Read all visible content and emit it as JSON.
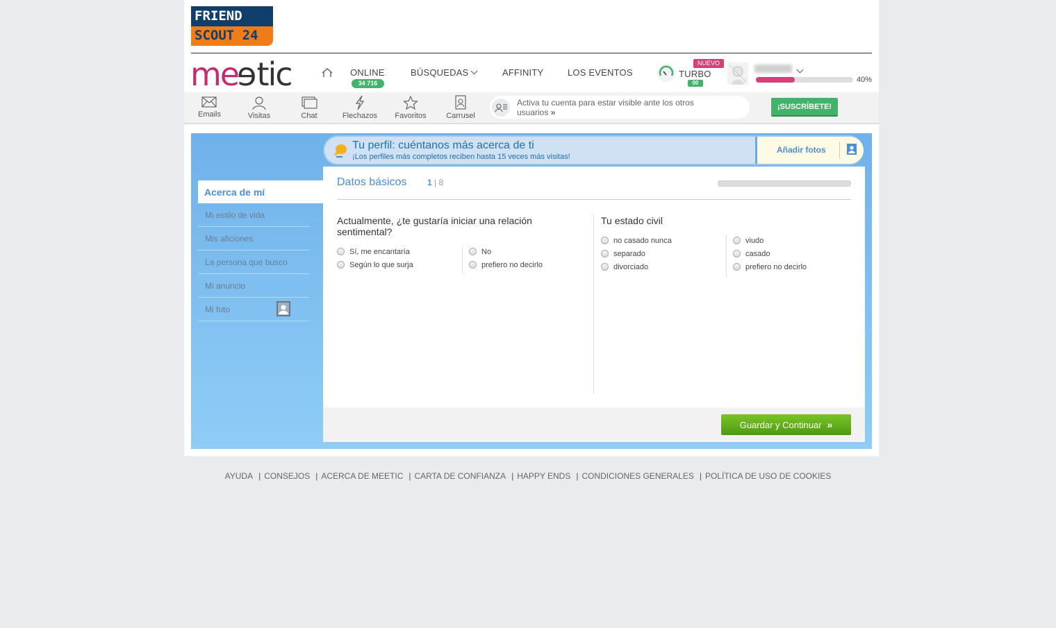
{
  "header": {
    "partner_logo_line1": "FRIEND",
    "partner_logo_line2": "SCOUT 24",
    "brand_logo": {
      "part1": "me",
      "part2": "e",
      "part3": "tic"
    },
    "nav": {
      "online_label": "ONLINE",
      "online_count": "34 716",
      "busquedas_label": "BÚSQUEDAS",
      "affinity_label": "AFFINITY",
      "eventos_label": "LOS EVENTOS",
      "turbo_label": "TURBO",
      "turbo_new_badge": "NUEVO",
      "turbo_count": "00"
    },
    "profile_progress": {
      "value": 40,
      "label": "40%"
    }
  },
  "toolbar": {
    "items": [
      {
        "label": "Emails",
        "icon": "envelope-icon"
      },
      {
        "label": "Visitas",
        "icon": "person-icon"
      },
      {
        "label": "Chat",
        "icon": "chat-icon"
      },
      {
        "label": "Flechazos",
        "icon": "lightning-icon"
      },
      {
        "label": "Favoritos",
        "icon": "star-icon"
      },
      {
        "label": "Carrusel",
        "icon": "carousel-icon"
      }
    ],
    "activate_text": "Activa tu cuenta para estar visible ante los otros usuarios",
    "activate_arrow": "»",
    "subscribe_label": "¡SUSCRÍBETE!"
  },
  "banner": {
    "title": "Tu perfil: cuéntanos más acerca de ti",
    "subtitle": "¡Los perfiles más completos reciben hasta 15 veces más visitas!",
    "add_photos_label": "Añadir fotos"
  },
  "sidebar": {
    "active": "Acerca de mí",
    "items": [
      "Mi estilo de vida",
      "Mis aficiones",
      "La persona que busco",
      "Mi anuncio",
      "Mi foto"
    ]
  },
  "form": {
    "section_title": "Datos básicos",
    "step_current": "1",
    "step_total": "| 8",
    "q1": {
      "text": "Actualmente, ¿te gustaría iniciar una relación sentimental?",
      "options_left": [
        "Sí, me encantaría",
        "Según lo que surja"
      ],
      "options_right": [
        "No",
        "prefiero no decirlo"
      ]
    },
    "q2": {
      "text": "Tu estado civil",
      "options_left": [
        "no casado nunca",
        "separado",
        "divorciado"
      ],
      "options_right": [
        "viudo",
        "casado",
        "prefiero no decirlo"
      ]
    },
    "save_label": "Guardar y Continuar",
    "save_arrow": "»"
  },
  "footer": {
    "links": [
      "AYUDA",
      "CONSEJOS",
      "ACERCA DE MEETIC",
      "CARTA DE CONFIANZA",
      "HAPPY ENDS",
      "CONDICIONES GENERALES",
      "POLÍTICA DE USO DE COOKIES"
    ],
    "separator": "|"
  },
  "colors": {
    "brand_pink": "#d4407a",
    "accent_blue": "#4b8ed1",
    "green": "#43b36b",
    "save_green": "#5fa918",
    "friendscout_navy": "#123e6b",
    "friendscout_orange": "#f07c17"
  }
}
